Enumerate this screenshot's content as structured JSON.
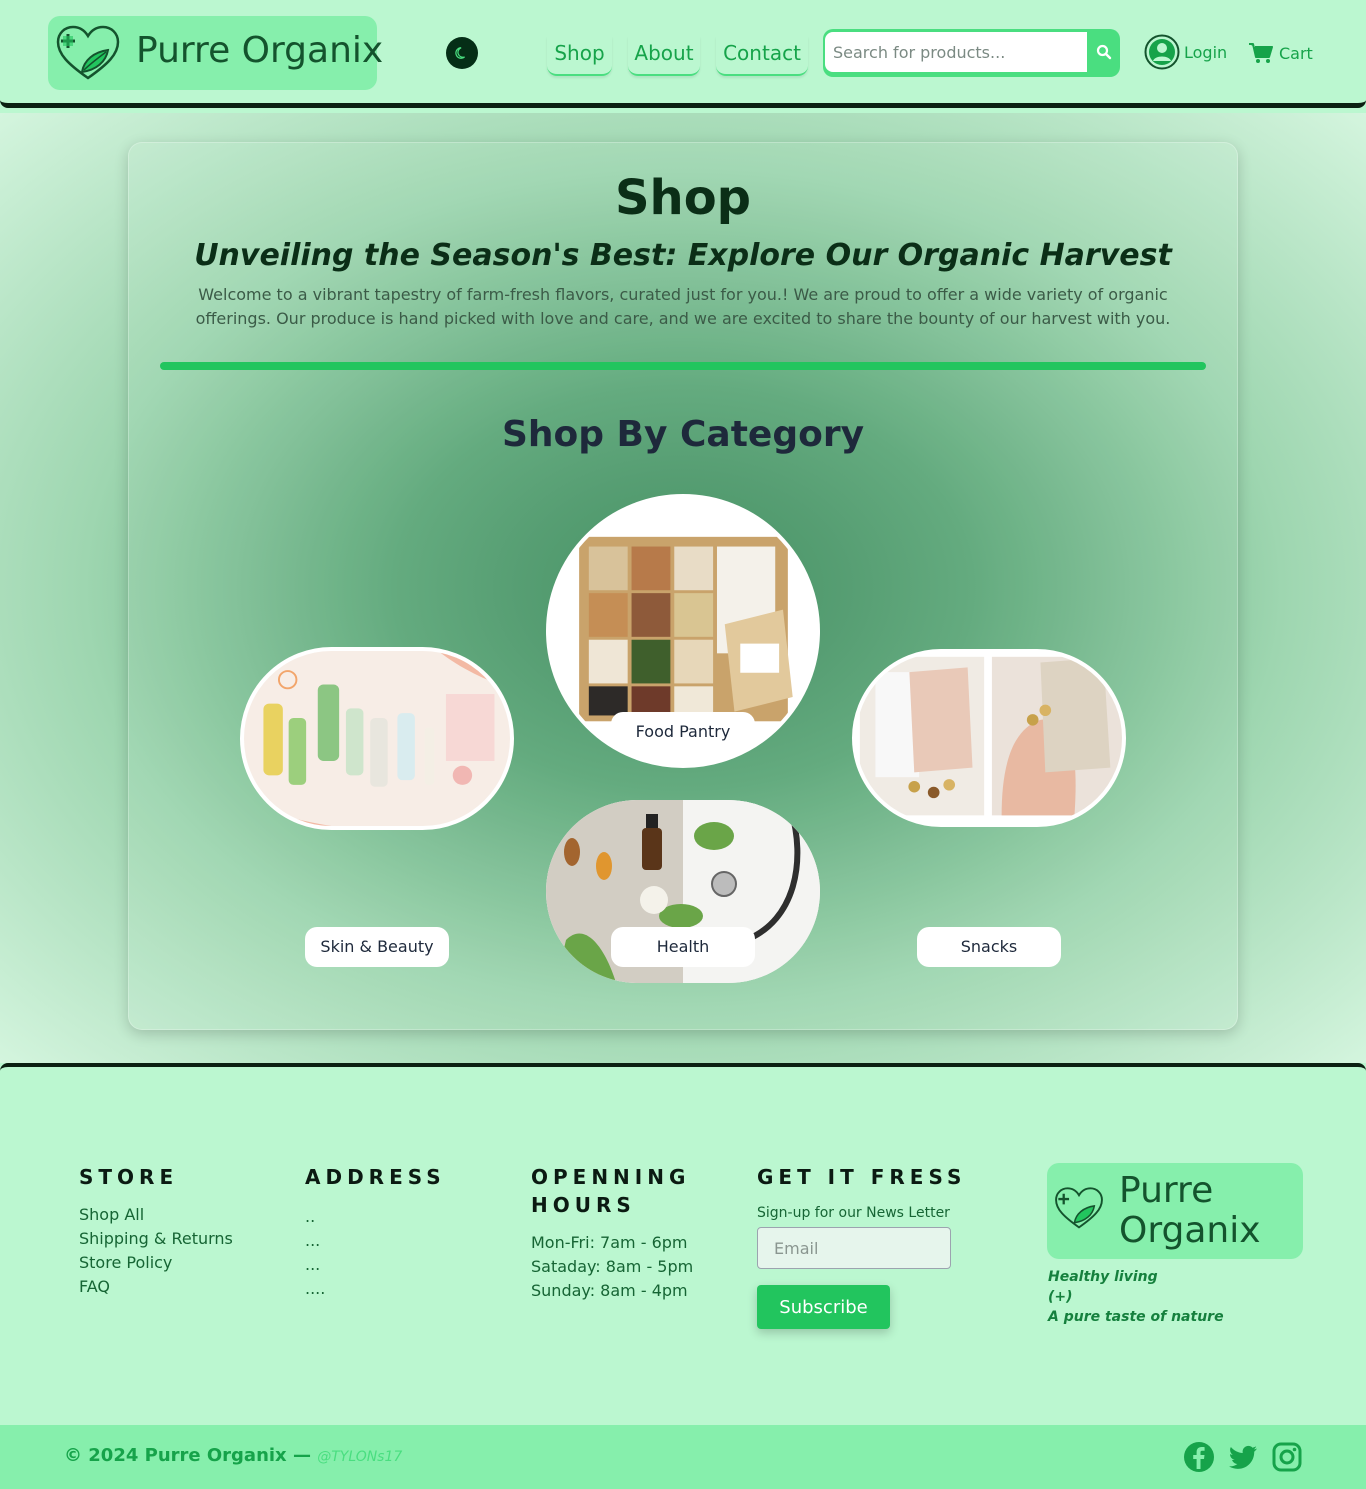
{
  "header": {
    "brand": "Purre Organix",
    "nav": [
      {
        "label": "Shop"
      },
      {
        "label": "About"
      },
      {
        "label": "Contact"
      }
    ],
    "search": {
      "placeholder": "Search for products..."
    },
    "login_label": "Login",
    "cart_label": "Cart",
    "icons": {
      "logo": "heart-leaf-icon",
      "theme": "moon-icon",
      "search": "search-icon",
      "user": "user-circle-icon",
      "cart": "cart-icon"
    }
  },
  "main": {
    "title": "Shop",
    "subtitle": "Unveiling the Season's Best: Explore Our Organic Harvest",
    "intro": "Welcome to a vibrant tapestry of farm-fresh flavors, curated just for you.! We are proud to offer a wide variety of organic offerings. Our produce is hand picked with love and care, and we are excited to share the bounty of our harvest with you.",
    "category_heading": "Shop By Category",
    "categories": [
      {
        "label": "Food Pantry"
      },
      {
        "label": "Skin & Beauty"
      },
      {
        "label": "Health"
      },
      {
        "label": "Snacks"
      }
    ]
  },
  "footer": {
    "store": {
      "heading": "STORE",
      "links": [
        "Shop All",
        "Shipping & Returns",
        "Store Policy",
        "FAQ"
      ]
    },
    "address": {
      "heading": "ADDRESS",
      "lines": [
        "..",
        "...",
        "...",
        "...."
      ]
    },
    "hours": {
      "heading": "OPENNING HOURS",
      "lines": [
        "Mon-Fri: 7am - 6pm",
        "Sataday: 8am - 5pm",
        "Sunday: 8am - 4pm"
      ]
    },
    "newsletter": {
      "heading": "GET IT FRESS",
      "caption": "Sign-up for our News Letter",
      "email_placeholder": "Email",
      "button": "Subscribe"
    },
    "brand": "Purre Organix",
    "taglines": [
      "Healthy living",
      "(+)",
      "A pure taste of nature"
    ],
    "copyright": "© 2024 Purre Organix —",
    "credit": "@TYLONs17",
    "social_icons": [
      "facebook-icon",
      "twitter-icon",
      "instagram-icon"
    ]
  },
  "colors": {
    "primary": "#22c55e",
    "header_bg": "#bbf7d0",
    "logo_bg": "#86efac",
    "dark": "#0b2012",
    "text_green": "#16a34a"
  }
}
